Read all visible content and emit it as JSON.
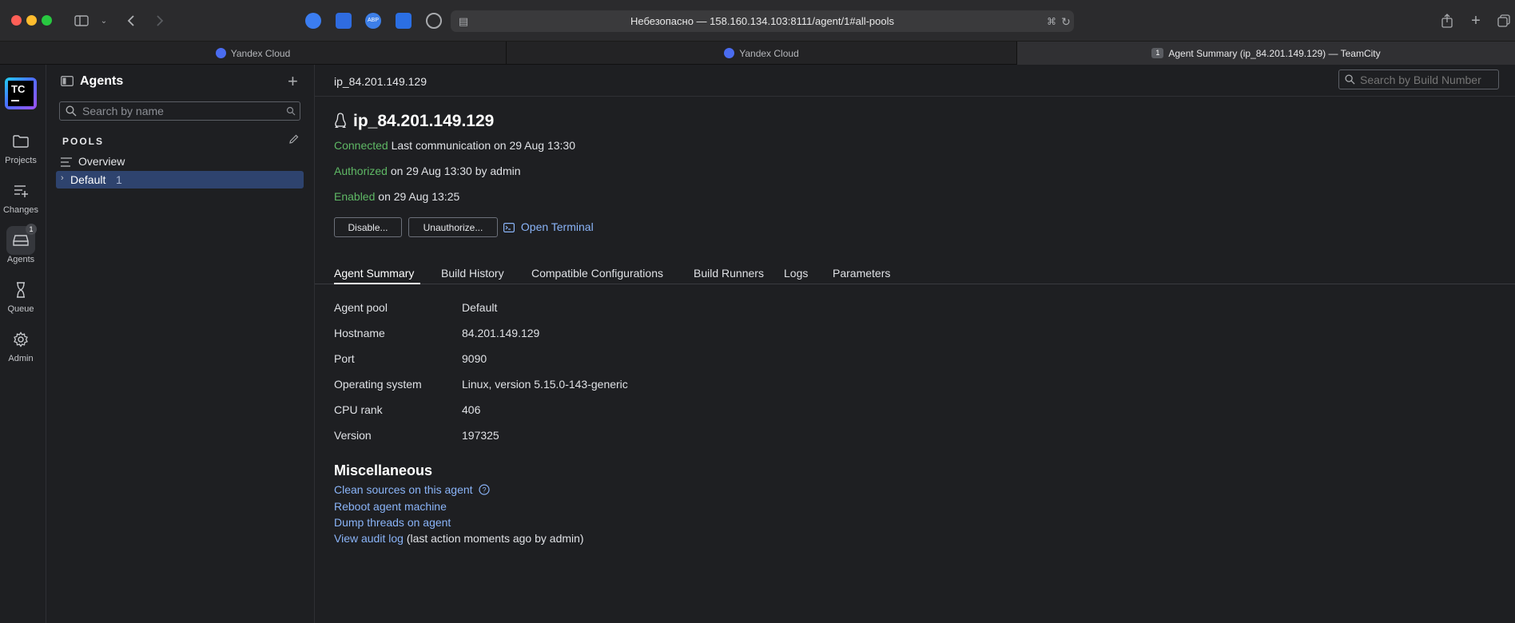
{
  "browser": {
    "url_prefix": "Небезопасно — ",
    "url": "158.160.134.103:8111/agent/1#all-pools",
    "tabs": [
      {
        "label": "Yandex Cloud"
      },
      {
        "label": "Yandex Cloud"
      },
      {
        "label": "Agent Summary (ip_84.201.149.129) — TeamCity",
        "badge": "1"
      }
    ]
  },
  "rail": {
    "logo": "TC",
    "items": [
      {
        "label": "Projects",
        "icon": "folder-icon"
      },
      {
        "label": "Changes",
        "icon": "changes-icon"
      },
      {
        "label": "Agents",
        "icon": "agents-icon",
        "badge": "1"
      },
      {
        "label": "Queue",
        "icon": "hourglass-icon"
      },
      {
        "label": "Admin",
        "icon": "gear-icon"
      }
    ]
  },
  "sidebar": {
    "title": "Agents",
    "search_placeholder": "Search by name",
    "pools_heading": "POOLS",
    "overview": "Overview",
    "pool": {
      "name": "Default",
      "count": "1"
    }
  },
  "header": {
    "breadcrumb": "ip_84.201.149.129",
    "build_search_placeholder": "Search by Build Number"
  },
  "agent": {
    "name": "ip_84.201.149.129",
    "connected_label": "Connected",
    "connected_text": "Last communication on 29 Aug 13:30",
    "authorized_label": "Authorized",
    "authorized_text": "on 29 Aug 13:30 by admin",
    "enabled_label": "Enabled",
    "enabled_text": "on 29 Aug 13:25",
    "disable_button": "Disable...",
    "unauthorize_button": "Unauthorize...",
    "terminal_link": "Open Terminal"
  },
  "tabs": [
    "Agent Summary",
    "Build History",
    "Compatible Configurations",
    "Build Runners",
    "Logs",
    "Parameters"
  ],
  "properties": [
    {
      "label": "Agent pool",
      "value": "Default",
      "link": true
    },
    {
      "label": "Hostname",
      "value": "84.201.149.129"
    },
    {
      "label": "Port",
      "value": "9090"
    },
    {
      "label": "Operating system",
      "value": "Linux, version 5.15.0-143-generic"
    },
    {
      "label": "CPU rank",
      "value": "406"
    },
    {
      "label": "Version",
      "value": "197325"
    }
  ],
  "misc": {
    "heading": "Miscellaneous",
    "clean_sources": "Clean sources on this agent",
    "reboot": "Reboot agent machine",
    "dump_threads": "Dump threads on agent",
    "audit_log": "View audit log",
    "audit_note": "(last action moments ago by admin)"
  },
  "colors": {
    "accent": "#8ab4f8",
    "status_green": "#5fb865",
    "selected_row": "#2e436e"
  }
}
